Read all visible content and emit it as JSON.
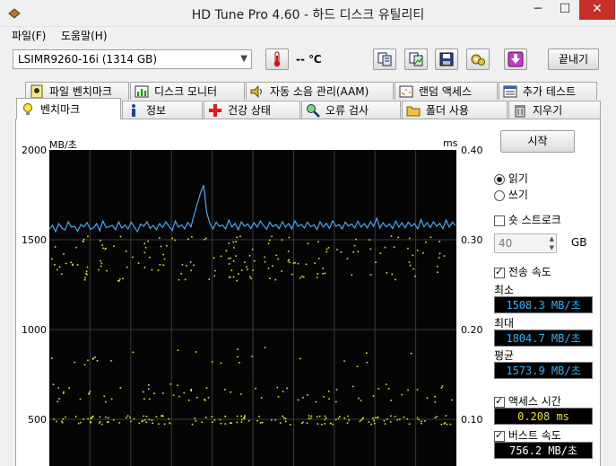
{
  "window": {
    "title": "HD Tune Pro 4.60 - 하드 디스크 유틸리티",
    "minimize": "─",
    "maximize": "☐",
    "close": "✕"
  },
  "menu": [
    "파일(F)",
    "도움말(H)"
  ],
  "toolbar": {
    "drive": "LSIMR9260-16i (1314 GB)",
    "temperature": "-- ℃",
    "exit_label": "끝내기",
    "icons": [
      "copy-text-icon",
      "copy-image-icon",
      "save-icon",
      "options-icon",
      "download-icon"
    ]
  },
  "tabs_top": [
    {
      "label": "파일 벤치마크",
      "icon": "file-benchmark-icon"
    },
    {
      "label": "디스크 모니터",
      "icon": "disk-monitor-icon"
    },
    {
      "label": "자동 소음 관리(AAM)",
      "icon": "speaker-icon"
    },
    {
      "label": "랜덤 액세스",
      "icon": "random-access-icon"
    },
    {
      "label": "추가 테스트",
      "icon": "extra-tests-icon"
    }
  ],
  "tabs_bottom": [
    {
      "label": "벤치마크",
      "icon": "lightbulb-icon",
      "selected": true
    },
    {
      "label": "정보",
      "icon": "info-icon"
    },
    {
      "label": "건강 상태",
      "icon": "health-cross-icon"
    },
    {
      "label": "오류 검사",
      "icon": "magnifier-icon"
    },
    {
      "label": "폴더 사용",
      "icon": "folder-icon"
    },
    {
      "label": "지우기",
      "icon": "trash-icon"
    }
  ],
  "controls": {
    "start_label": "시작",
    "read_label": "읽기",
    "write_label": "쓰기",
    "mode": "read",
    "short_stroke_label": "숏 스트로크",
    "short_stroke_checked": false,
    "short_stroke_value": "40",
    "short_stroke_unit": "GB",
    "transfer_label": "전송 속도",
    "transfer_checked": true,
    "min_label": "최소",
    "min_value": "1508.3 MB/초",
    "max_label": "최대",
    "max_value": "1804.7 MB/초",
    "avg_label": "평균",
    "avg_value": "1573.9 MB/초",
    "access_label": "액세스 시간",
    "access_checked": true,
    "access_value": "0.208 ms",
    "burst_label": "버스트 속도",
    "burst_checked": true,
    "burst_value": "756.2 MB/초"
  },
  "colors": {
    "line": "#3fa9f5",
    "dots": "#e6e600",
    "chart_bg": "#050505",
    "stat_text": "#1eb4ff",
    "access_text": "#f0e000"
  },
  "chart_data": {
    "type": "line",
    "ylabel": "MB/초",
    "y2label": "ms",
    "y_ticks": [
      "2000",
      "1500",
      "1000",
      "500"
    ],
    "y2_ticks": [
      "0.40",
      "0.30",
      "0.20",
      "0.10"
    ],
    "ylim": [
      0,
      2000
    ],
    "y2lim": [
      0,
      0.4
    ],
    "grid": true,
    "series": [
      {
        "type": "line",
        "values": [
          1560,
          1580,
          1545,
          1590,
          1565,
          1555,
          1600,
          1570,
          1575,
          1548,
          1585,
          1572,
          1596,
          1558,
          1566,
          1590,
          1550,
          1605,
          1568,
          1573,
          1580,
          1556,
          1600,
          1565,
          1582,
          1560,
          1598,
          1570,
          1545,
          1588,
          1575,
          1600,
          1562,
          1580,
          1556,
          1590,
          1568,
          1600,
          1575,
          1552,
          1604,
          1570,
          1583,
          1560,
          1596,
          1572,
          1640,
          1700,
          1760,
          1804,
          1650,
          1590,
          1560,
          1598,
          1575,
          1582,
          1560,
          1610,
          1570,
          1592,
          1555,
          1600,
          1575,
          1588,
          1562,
          1595,
          1570,
          1604,
          1580,
          1558,
          1597,
          1573,
          1585,
          1562,
          1600,
          1570,
          1590,
          1560,
          1605,
          1574,
          1586,
          1565,
          1598,
          1572,
          1583,
          1557,
          1600,
          1570,
          1592,
          1563,
          1606,
          1575,
          1585,
          1560,
          1598,
          1576,
          1588,
          1565,
          1603,
          1570,
          1590,
          1566,
          1600,
          1575,
          1620,
          1565,
          1595,
          1572,
          1588,
          1562,
          1604,
          1570,
          1594,
          1566,
          1598,
          1575,
          1590,
          1560,
          1612,
          1572,
          1595,
          1568,
          1600,
          1575,
          1591,
          1562,
          1610,
          1570,
          1598,
          1580
        ]
      },
      {
        "type": "scatter",
        "description_units": "ms",
        "clusters": [
          {
            "y_ms": 0.28,
            "spread": 0.025,
            "count": 180
          },
          {
            "y_ms": 0.17,
            "spread": 0.012,
            "count": 25
          },
          {
            "y_ms": 0.13,
            "spread": 0.01,
            "count": 70
          },
          {
            "y_ms": 0.1,
            "spread": 0.005,
            "count": 150
          }
        ]
      }
    ]
  }
}
